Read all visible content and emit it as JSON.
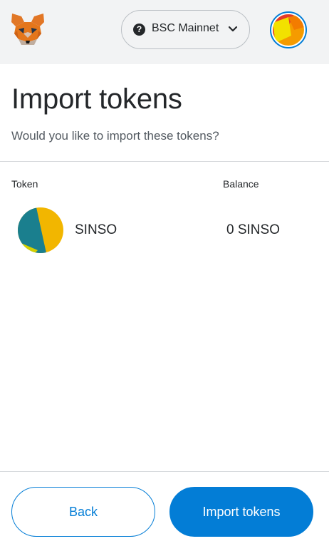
{
  "header": {
    "network": {
      "label": "BSC Mainnet",
      "help_glyph": "?",
      "icon": "question-icon"
    },
    "logo_icon": "metamask-fox-icon",
    "avatar_icon": "account-identicon"
  },
  "page": {
    "title": "Import tokens",
    "subtitle": "Would you like to import these tokens?"
  },
  "table": {
    "columns": [
      "Token",
      "Balance"
    ],
    "rows": [
      {
        "symbol": "SINSO",
        "balance": "0 SINSO",
        "icon": "token-identicon"
      }
    ]
  },
  "footer": {
    "back_label": "Back",
    "import_label": "Import tokens"
  },
  "colors": {
    "accent": "#037dd6",
    "header_bg": "#f2f3f4",
    "text": "#24272a",
    "divider": "#d6d9dc"
  }
}
